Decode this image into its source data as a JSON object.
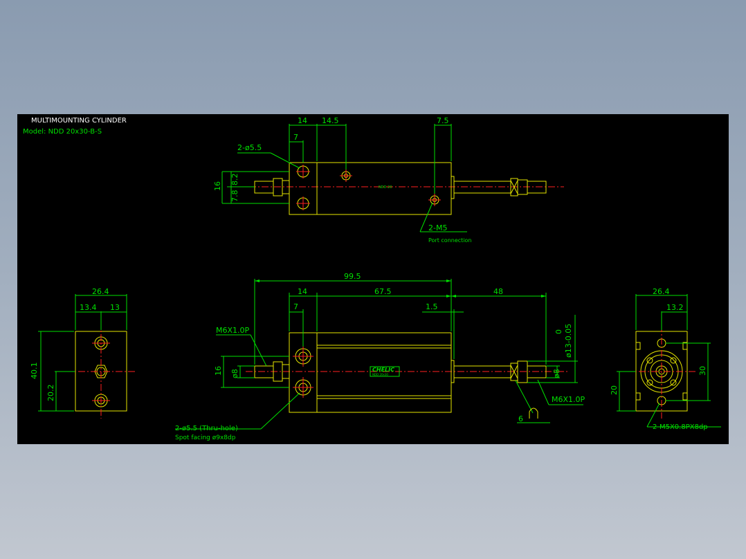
{
  "title": "MULTIMOUNTING CYLINDER",
  "model": "Model: NDD 20x30-B-S",
  "colors": {
    "background": "#000000",
    "dimension": "#00e000",
    "outline": "#e6e600",
    "centerline": "#ff2020",
    "window": "#9aa8ba"
  },
  "top_view": {
    "dims": {
      "d14": "14",
      "d14_5": "14.5",
      "d7_5": "7.5",
      "d7": "7",
      "d16": "16",
      "d8_2": "8.2",
      "d7_8": "7.8"
    },
    "hole_label": "2-ø5.5",
    "port_label": "2-M5",
    "port_note": "Port connection",
    "body_tag": "NDD 20"
  },
  "front_view": {
    "dims": {
      "d99_5": "99.5",
      "d14": "14",
      "d67_5": "67.5",
      "d48": "48",
      "d7": "7",
      "d1_5": "1.5",
      "d16": "16",
      "d8": "ø8",
      "d8r": "ø8",
      "d13": "ø13-0.05",
      "d13_upper": "0",
      "d6": "6"
    },
    "thread_left": "M6X1.0P",
    "thread_right": "M6X1.0P",
    "hole_label": "2-ø5.5 (Thru-hole)",
    "spot_facing": "Spot facing   ø9x8dp",
    "logo": "CHELIC",
    "logo_sub": "NDD 20x30"
  },
  "left_view": {
    "dims": {
      "d26_4": "26.4",
      "d13_4": "13.4",
      "d13": "13",
      "d40_1": "40.1",
      "d20_2": "20.2"
    }
  },
  "right_view": {
    "dims": {
      "d26_4": "26.4",
      "d13_2": "13.2",
      "d30": "30",
      "d20": "20"
    },
    "tap_label": "2-M5X0.8PX8dp"
  }
}
